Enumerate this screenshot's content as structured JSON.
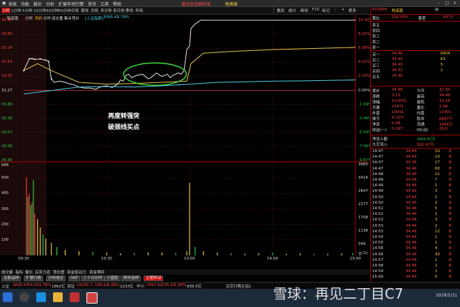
{
  "menu": {
    "items": [
      "系统",
      "功能",
      "报价",
      "分析",
      "扩展市场行情",
      "资讯",
      "工具",
      "帮助"
    ],
    "title": "通达信金融终端",
    "subtitle": "牧高笛"
  },
  "window_buttons": [
    "–",
    "□",
    "×"
  ],
  "toolbar": {
    "period_tabs": [
      "分时",
      "1分钟",
      "5分钟",
      "15分钟",
      "30分钟",
      "60分钟",
      "日线",
      "周线",
      "月线",
      "多分钟",
      "多日线",
      "季线",
      "年线"
    ],
    "right_items": [
      "叠加",
      "统计",
      "画线",
      "F10",
      "标记",
      "-",
      "+",
      "更多"
    ]
  },
  "chart_header": {
    "stock": "牧高笛",
    "tabs": [
      "分时",
      "均价",
      "分时",
      "成交量",
      "集合竞价"
    ],
    "index_label": "上证指数",
    "index_value": "3095.47",
    "index_change": "1.78%"
  },
  "price_axis": {
    "left": [
      "34.46",
      "33.85",
      "33.24",
      "32.63",
      "32.02",
      "31.27",
      "30.89",
      "30.28",
      "29.67",
      "29.06",
      "28.45"
    ],
    "right": [
      "10.02%",
      "8.05%",
      "6.08%",
      "4.11%",
      "2.14%",
      "0.00%",
      "-1.99%",
      "-3.96%",
      "-5.93%",
      "-7.90%",
      "-9.87%"
    ]
  },
  "volume_axis": {
    "left_top": "666",
    "left": [
      "500",
      "400",
      "300",
      "200",
      "100"
    ],
    "right": [
      "3885",
      "3416",
      "2847",
      "2277",
      "1708",
      "1138",
      "569"
    ],
    "label": "手",
    "sub_label": "(1)"
  },
  "time_axis": [
    "09:30",
    "10:30",
    "13:00",
    "14:00",
    "15:00"
  ],
  "annotation": {
    "line1": "再度转强突",
    "line2": "破颈线买点"
  },
  "chart_data": {
    "type": "line",
    "title": "",
    "x_unit": "minutes from 09:30",
    "ylim": [
      28.45,
      34.46
    ],
    "prev_close": 31.27,
    "series": [
      {
        "name": "分时",
        "x": [
          0,
          4,
          6,
          8,
          12,
          16,
          18,
          20,
          22,
          26,
          30,
          32,
          36,
          40,
          44,
          48,
          52,
          56,
          60,
          64,
          68,
          70,
          72,
          74,
          76,
          78,
          80,
          82,
          86,
          90,
          92,
          96,
          100,
          104,
          106,
          108,
          112,
          114,
          116,
          118,
          120,
          121,
          124,
          128,
          132,
          136,
          140,
          180,
          240
        ],
        "y": [
          32.3,
          32.8,
          32.82,
          32.78,
          32.8,
          32.75,
          32.7,
          31.95,
          31.8,
          31.85,
          31.8,
          31.75,
          31.7,
          31.6,
          31.55,
          31.55,
          31.5,
          31.62,
          31.65,
          31.58,
          31.72,
          31.9,
          31.85,
          32.1,
          32.15,
          32.0,
          32.05,
          32.1,
          32.15,
          31.95,
          32.0,
          32.2,
          32.05,
          32.15,
          32.0,
          32.1,
          32.2,
          32.15,
          32.3,
          33.2,
          33.35,
          34.1,
          34.3,
          34.46,
          34.46,
          34.46,
          34.46,
          34.46,
          34.46
        ]
      },
      {
        "name": "均价",
        "x": [
          0,
          10,
          20,
          40,
          60,
          80,
          100,
          118,
          121,
          130,
          150,
          180,
          210,
          240
        ],
        "y": [
          32.3,
          32.6,
          32.3,
          31.8,
          31.72,
          31.75,
          31.8,
          31.85,
          32.6,
          33.05,
          33.12,
          33.2,
          33.25,
          33.3
        ]
      },
      {
        "name": "上证指数",
        "x": [
          0,
          20,
          40,
          60,
          80,
          100,
          120,
          140,
          160,
          180,
          200,
          220,
          240
        ],
        "y": [
          31.3,
          31.45,
          31.6,
          31.62,
          31.6,
          31.65,
          31.72,
          31.8,
          31.82,
          31.85,
          31.86,
          31.88,
          31.9
        ]
      }
    ]
  },
  "panel": {
    "code": "603908",
    "name": "牧高笛",
    "weibi_label": "委比",
    "weibi_value": "100.00%",
    "weicha_label": "委差",
    "weicha_value": "6473",
    "asks": [
      {
        "label": "卖五",
        "price": "",
        "vol": ""
      },
      {
        "label": "卖四",
        "price": "",
        "vol": ""
      },
      {
        "label": "卖三",
        "price": "",
        "vol": ""
      },
      {
        "label": "卖二",
        "price": "",
        "vol": ""
      },
      {
        "label": "卖一",
        "price": "",
        "vol": ""
      }
    ],
    "bids": [
      {
        "label": "买一",
        "price": "34.46",
        "vol": "6404"
      },
      {
        "label": "买二",
        "price": "34.45",
        "vol": "63"
      },
      {
        "label": "买三",
        "price": "34.40",
        "vol": "5"
      },
      {
        "label": "买四",
        "price": "34.32",
        "vol": "1"
      },
      {
        "label": "买五",
        "price": "34.30",
        "vol": ""
      }
    ],
    "stats": [
      {
        "k1": "现价",
        "v1": "34.46",
        "k2": "今开",
        "v2": "31.30"
      },
      {
        "k1": "涨跌",
        "v1": "3.13",
        "k2": "最高",
        "v2": "34.46"
      },
      {
        "k1": "涨幅",
        "v1": "10.00%",
        "k2": "最低",
        "v2": "31.16"
      },
      {
        "k1": "总量",
        "v1": "21471",
        "k2": "量比",
        "v2": "1.98"
      },
      {
        "k1": "外盘",
        "v1": "10091",
        "k2": "内盘",
        "v2": "11401"
      },
      {
        "k1": "换手",
        "v1": "9.32%",
        "k2": "股本",
        "v2": "6667万"
      },
      {
        "k1": "净资",
        "v1": "6.98",
        "k2": "流通",
        "v2": "2304万"
      },
      {
        "k1": "收益(一)",
        "v1": "0.297",
        "k2": "PE(动)",
        "v2": "29.0"
      }
    ],
    "flow": [
      {
        "label": "净流入额",
        "value": "-644.47万"
      },
      {
        "label": "大宗流入",
        "value": "591.47万"
      }
    ],
    "ticks": [
      {
        "t": "14:47",
        "p": "34.46",
        "v": "10"
      },
      {
        "t": "14:47",
        "p": "34.46",
        "v": "10"
      },
      {
        "t": "14:47",
        "p": "34.46",
        "v": "17"
      },
      {
        "t": "14:47",
        "p": "34.46",
        "v": "60"
      },
      {
        "t": "14:48",
        "p": "34.46",
        "v": "11"
      },
      {
        "t": "14:49",
        "p": "34.46",
        "v": "7"
      },
      {
        "t": "14:49",
        "p": "34.46",
        "v": "1"
      },
      {
        "t": "14:49",
        "p": "34.46",
        "v": "3"
      },
      {
        "t": "14:50",
        "p": "34.46",
        "v": "1"
      },
      {
        "t": "14:50",
        "p": "34.46",
        "v": "2"
      },
      {
        "t": "14:51",
        "p": "34.46",
        "v": "5"
      },
      {
        "t": "14:51",
        "p": "34.46",
        "v": "1"
      },
      {
        "t": "14:52",
        "p": "34.46",
        "v": "3"
      },
      {
        "t": "14:53",
        "p": "34.46",
        "v": "2"
      },
      {
        "t": "14:53",
        "p": "34.46",
        "v": "12"
      },
      {
        "t": "14:54",
        "p": "34.46",
        "v": "1"
      },
      {
        "t": "14:55",
        "p": "34.46",
        "v": "1"
      },
      {
        "t": "14:56",
        "p": "34.46",
        "v": "4"
      },
      {
        "t": "14:56",
        "p": "34.46",
        "v": "30"
      },
      {
        "t": "14:57",
        "p": "34.46",
        "v": "1"
      },
      {
        "t": "14:58",
        "p": "34.46",
        "v": "2"
      },
      {
        "t": "14:59",
        "p": "34.46",
        "v": "1"
      },
      {
        "t": "15:00",
        "p": "34.46",
        "v": "5"
      }
    ]
  },
  "sub_tabs": [
    "成交量",
    "指标",
    "量比",
    "买卖力道",
    "竞价图",
    "资金驱动力",
    "资金博弈"
  ],
  "bottom_tabs": [
    {
      "label": "关联品种",
      "active": false
    },
    {
      "label": "扩展行情",
      "active": false
    },
    {
      "label": "分时成交",
      "active": false
    },
    {
      "label": "DKF",
      "active": false
    },
    {
      "label": "二十日分时",
      "active": false
    },
    {
      "label": "小盘股",
      "active": false
    },
    {
      "label": "两年涨停",
      "active": false
    },
    {
      "label": "主题异动",
      "active": true
    }
  ],
  "ticker": {
    "sh_label": "上证",
    "sh_value": "3095.47",
    "sh_chg": "54.03",
    "sh_pct": "1.78%",
    "sh_amt": "1862亿",
    "sz_label": "深证",
    "sz_value": "10295.7",
    "sz_chg": "189.93",
    "sz_pct": "1.88%",
    "sz_amt": "2233亿",
    "zx_label": "中小",
    "zx_value": "7097.42",
    "zx_chg": "135.47",
    "zx_pct": "1.95%",
    "zx_amt": "939.5亿",
    "server": "北京行情主站1"
  },
  "watermark": "雪球：再见二丁目C7",
  "clock": {
    "date": "2018/5/11"
  }
}
